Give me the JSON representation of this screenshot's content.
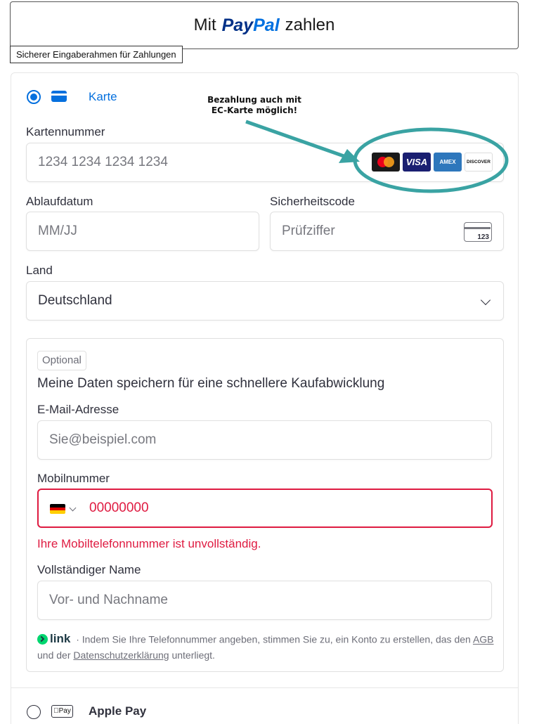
{
  "paypal_button": {
    "prefix": "Mit",
    "brand_pay": "Pay",
    "brand_pal": "Pal",
    "suffix": "zahlen"
  },
  "secure_frame_label": "Sicherer Eingaberahmen für Zahlungen",
  "annotation": {
    "line1": "Bezahlung auch mit",
    "line2": "EC-Karte möglich!",
    "color": "#3aa3a3"
  },
  "payment_methods": {
    "card": {
      "label": "Karte",
      "selected": true
    },
    "apple_pay": {
      "label": "Apple Pay",
      "badge": "Pay",
      "selected": false
    }
  },
  "card_form": {
    "card_number_label": "Kartennummer",
    "card_number_placeholder": "1234 1234 1234 1234",
    "card_brands": [
      "mastercard-icon",
      "visa-icon",
      "amex-icon",
      "discover-icon"
    ],
    "brand_visa": "VISA",
    "brand_amex": "AMEX",
    "brand_discover": "DISCOVER",
    "expiry_label": "Ablaufdatum",
    "expiry_placeholder": "MM/JJ",
    "cvc_label": "Sicherheitscode",
    "cvc_placeholder": "Prüfziffer",
    "cvc_icon_text": "123",
    "country_label": "Land",
    "country_value": "Deutschland"
  },
  "link_section": {
    "optional_badge": "Optional",
    "title": "Meine Daten speichern für eine schnellere Kaufabwicklung",
    "email_label": "E-Mail-Adresse",
    "email_placeholder": "Sie@beispiel.com",
    "phone_label": "Mobilnummer",
    "phone_value": "00000000",
    "phone_error": "Ihre Mobiltelefonnummer ist unvollständig.",
    "name_label": "Vollständiger Name",
    "name_placeholder": "Vor- und Nachname",
    "link_brand": "link",
    "terms_text_1": "· Indem Sie Ihre Telefonnummer angeben, stimmen Sie zu, ein Konto zu erstellen, das den",
    "terms_agb": "AGB",
    "terms_text_2": "und der",
    "terms_privacy": "Datenschutzerklärung",
    "terms_text_3": "unterliegt."
  },
  "colors": {
    "accent": "#0570de",
    "error": "#df1b41",
    "link_green": "#00d66f"
  }
}
